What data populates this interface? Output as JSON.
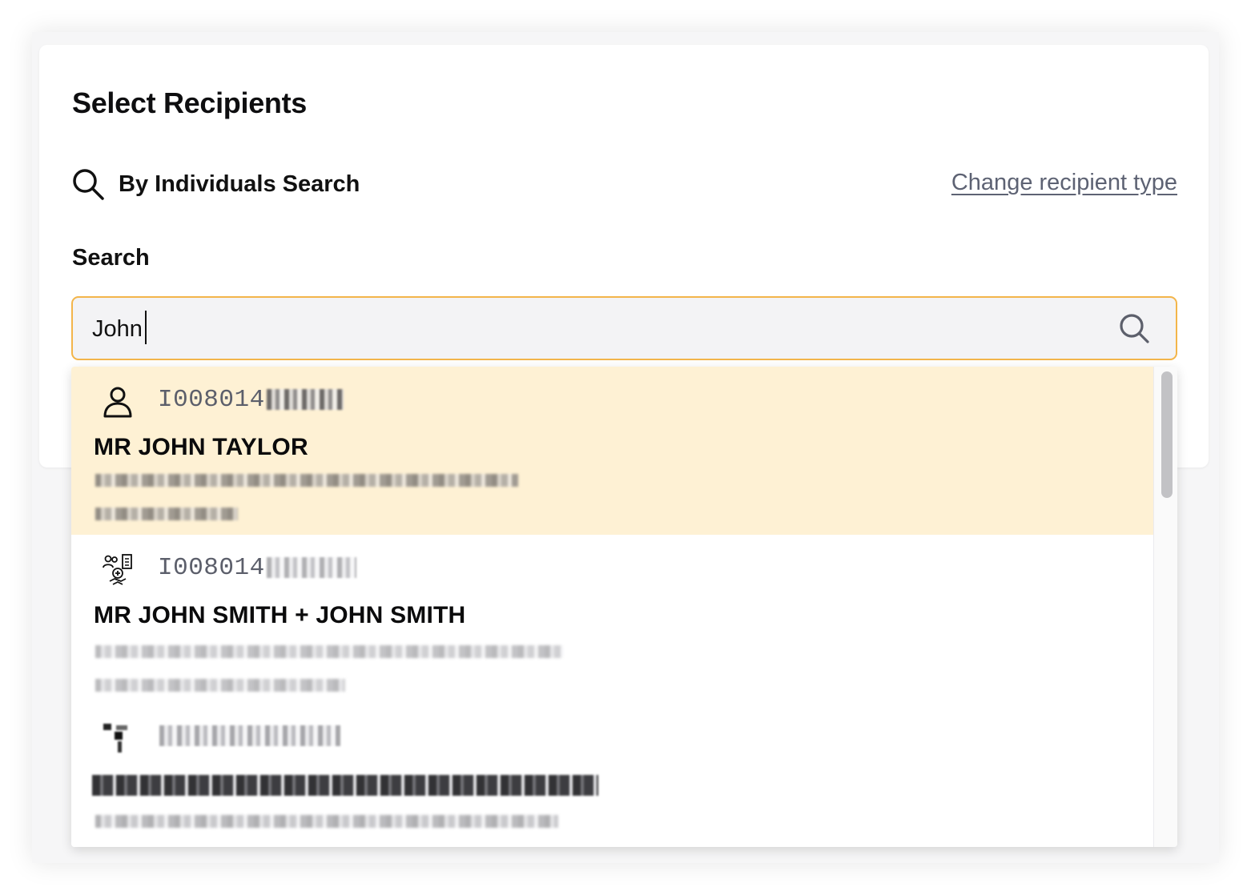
{
  "panel": {
    "title": "Select Recipients",
    "mode_label": "By Individuals Search",
    "mode_icon": "search-icon",
    "change_link": "Change recipient type",
    "search_label": "Search"
  },
  "search": {
    "value": "John",
    "button_icon": "search-icon",
    "accent_color": "#f3b54a"
  },
  "results": [
    {
      "icon": "person-icon",
      "id_prefix": "I008014",
      "name": "MR JOHN TAYLOR",
      "highlighted": true
    },
    {
      "icon": "group-household-icon",
      "id_prefix": "I008014",
      "name": "MR JOHN SMITH + JOHN SMITH",
      "highlighted": false
    },
    {
      "icon": "organisation-icon",
      "id_prefix": "",
      "name": "",
      "highlighted": false
    }
  ],
  "colors": {
    "highlight": "#fef1d4",
    "link": "#5d6273"
  }
}
